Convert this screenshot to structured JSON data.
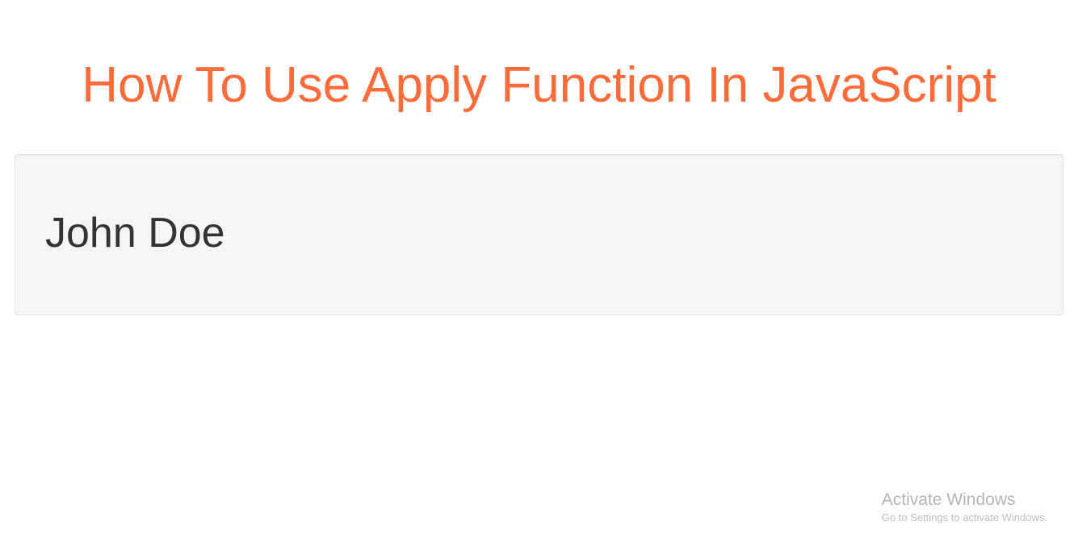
{
  "header": {
    "title": "How To Use Apply Function In JavaScript"
  },
  "well": {
    "output": "John Doe"
  },
  "watermark": {
    "title": "Activate Windows",
    "subtitle": "Go to Settings to activate Windows."
  }
}
